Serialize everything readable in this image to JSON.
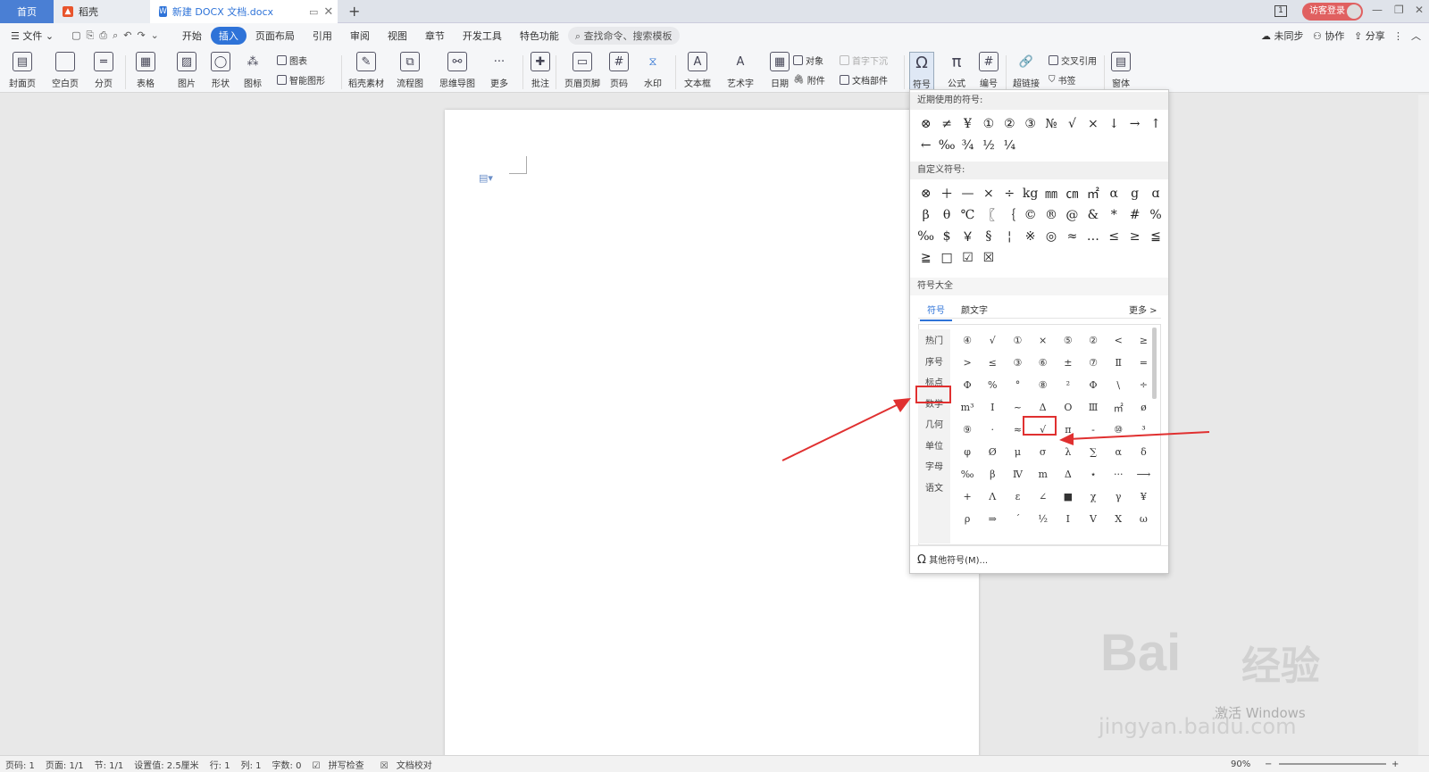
{
  "tabs": {
    "home": "首页",
    "daoke": "稻壳",
    "doc": "新建 DOCX 文档.docx",
    "new_tab": "+"
  },
  "title_right": {
    "login": "访客登录",
    "badge": "1"
  },
  "menu": {
    "file": "文件",
    "items": [
      "开始",
      "插入",
      "页面布局",
      "引用",
      "审阅",
      "视图",
      "章节",
      "开发工具",
      "特色功能"
    ],
    "active": "插入",
    "search": "查找命令、搜索模板",
    "right": [
      "未同步",
      "协作",
      "分享"
    ]
  },
  "ribbon": {
    "cover": "封面页",
    "blank": "空白页",
    "pagebreak": "分页",
    "table": "表格",
    "picture": "图片",
    "shape": "形状",
    "icon": "图标",
    "chart": "图表",
    "smartart": "智能图形",
    "daoke_material": "稻壳素材",
    "flowchart": "流程图",
    "mindmap": "思维导图",
    "more": "更多",
    "comment": "批注",
    "header_footer": "页眉页脚",
    "page_number": "页码",
    "watermark": "水印",
    "textbox": "文本框",
    "wordart": "艺术字",
    "date": "日期",
    "object": "对象",
    "attachment": "附件",
    "dropcap": "首字下沉",
    "docpart": "文档部件",
    "symbol": "符号",
    "formula": "公式",
    "numbering": "编号",
    "hyperlink": "超链接",
    "crossref": "交叉引用",
    "bookmark": "书签",
    "window": "窗体"
  },
  "panel": {
    "recent_title": "近期使用的符号:",
    "recent": [
      "⊗",
      "≠",
      "¥",
      "①",
      "②",
      "③",
      "№",
      "√",
      "×",
      "↓",
      "→",
      "↑",
      "←",
      "‰",
      "¾",
      "½",
      "¼"
    ],
    "custom_title": "自定义符号:",
    "custom": [
      "⊗",
      "＋",
      "—",
      "×",
      "÷",
      "kg",
      "㎜",
      "㎝",
      "㎡",
      "α",
      "g",
      "ɑ",
      "β",
      "θ",
      "℃",
      "〖",
      "｛",
      "©",
      "®",
      "@",
      "&",
      "*",
      "#",
      "%",
      "‰",
      "$",
      "￥",
      "§",
      "¦",
      "※",
      "◎",
      "≈",
      "…",
      "≤",
      "≥",
      "≦",
      "≧",
      "□",
      "☑",
      "☒"
    ],
    "all_title": "符号大全",
    "tab_symbol": "符号",
    "tab_kaomoji": "颜文字",
    "more": "更多 >",
    "categories": [
      "热门",
      "序号",
      "标点",
      "数学",
      "几何",
      "单位",
      "字母",
      "语文"
    ],
    "selected_category": "数学",
    "symbols": [
      "④",
      "√",
      "①",
      "×",
      "⑤",
      "②",
      "<",
      "≥",
      ">",
      "≤",
      "③",
      "⑥",
      "±",
      "⑦",
      "Ⅱ",
      "=",
      "Φ",
      "%",
      "°",
      "⑧",
      "²",
      "Φ",
      "\\",
      "÷",
      "m³",
      "Ⅰ",
      "~",
      "Δ",
      "Ο",
      "Ⅲ",
      "㎡",
      "ø",
      "⑨",
      "·",
      "≈",
      "√",
      "π",
      "-",
      "⑩",
      "³",
      "φ",
      "Ø",
      "μ",
      "σ",
      "λ",
      "∑",
      "α",
      "δ",
      "‰",
      "β",
      "Ⅳ",
      "m",
      "Δ",
      "⋆",
      "···",
      "⟶",
      "+",
      "Λ",
      "ε",
      "∠",
      "■",
      "χ",
      "γ",
      "¥",
      "ρ",
      "⇒",
      "ˊ",
      "½",
      "Ι",
      "V",
      "Χ",
      "ω"
    ],
    "highlight_symbol": "√",
    "other_symbols": "其他符号(M)..."
  },
  "statusbar": {
    "items": [
      "页码: 1",
      "页面: 1/1",
      "节: 1/1",
      "设置值: 2.5厘米",
      "行: 1",
      "列: 1",
      "字数: 0"
    ],
    "spellcheck": "拼写检查",
    "proofread": "文档校对",
    "zoom": "90%"
  },
  "watermark": {
    "line1": "Bai",
    "line2": "经验",
    "line3": "激活 Windows",
    "line4": "jingyan.baidu.com"
  },
  "colors": {
    "accent": "#2e73d8",
    "highlight": "#e03030",
    "login_bg": "#e06060"
  }
}
